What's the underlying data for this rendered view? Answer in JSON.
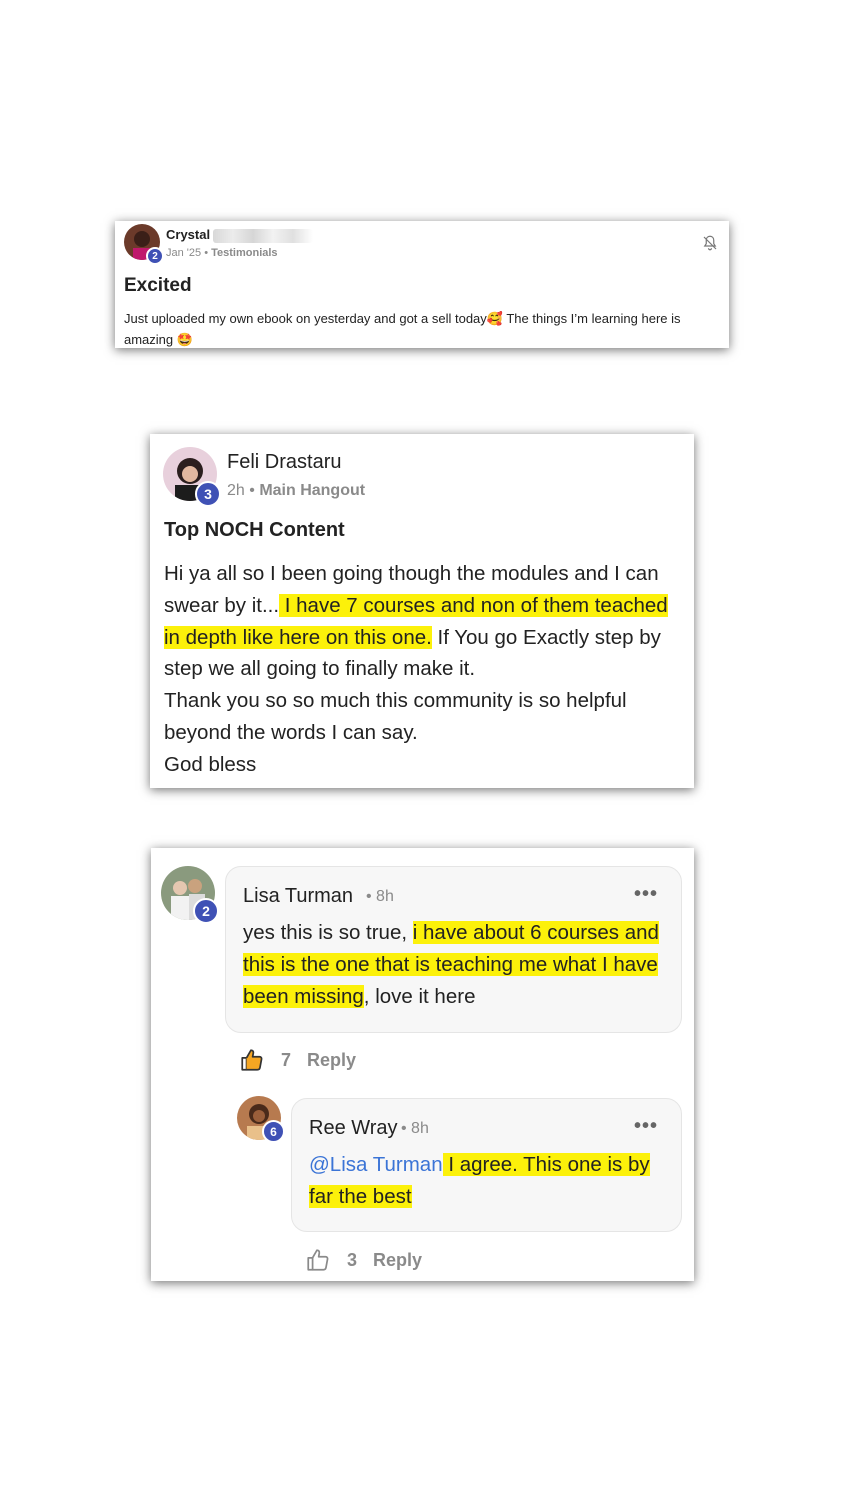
{
  "post1": {
    "author": "Crystal",
    "level": "2",
    "date": "Jan '25",
    "separator": "•",
    "category": "Testimonials",
    "title": "Excited",
    "body_part1": "Just uploaded my own ebook on yesterday and got a sell today",
    "emoji1": "🥰",
    "body_part2": " The things I’m learning here is amazing ",
    "emoji2": "🤩",
    "bell_icon": "bell-off-icon"
  },
  "post2": {
    "author": "Feli Drastaru",
    "level": "3",
    "time": "2h",
    "separator": "•",
    "category": "Main Hangout",
    "title": "Top NOCH Content",
    "body_pre": "Hi ya all so I been going though the modules and I can swear by it...",
    "body_highlight": " I have 7 courses and non of them teached in depth like here on this one.",
    "body_post": " If You go Exactly step by step we all going to finally make it.",
    "line2": "Thank you so so much this community is so helpful beyond the words I can say.",
    "line3": "God bless"
  },
  "comment1": {
    "author": "Lisa Turman",
    "level": "2",
    "time": "• 8h",
    "menu": "•••",
    "body_pre": "yes this is so true, ",
    "body_highlight": "i have about 6 courses and this is the one that is teaching me what I have been missing",
    "body_post": ", love it here",
    "likes": "7",
    "reply_label": "Reply",
    "like_icon": "thumbs-up-icon",
    "like_color": "#f5a623"
  },
  "comment2": {
    "author": "Ree Wray",
    "level": "6",
    "time": "• 8h",
    "menu": "•••",
    "mention": "@Lisa Turman",
    "body_highlight": " I agree. This one is by far the best ",
    "likes": "3",
    "reply_label": "Reply",
    "like_icon": "thumbs-up-outline-icon"
  },
  "colors": {
    "highlight": "#fcf10a",
    "level_badge": "#3f51b5",
    "mention": "#3b74d6"
  }
}
